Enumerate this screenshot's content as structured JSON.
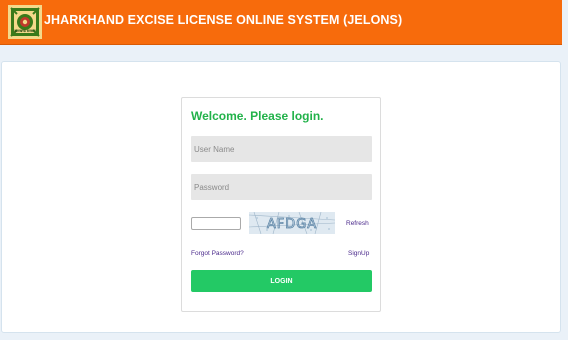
{
  "header": {
    "title": "JHARKHAND EXCISE LICENSE ONLINE SYSTEM (JELONS)",
    "logo_caption": "झारखण्ड सरकार",
    "background_color": "#f76b0c"
  },
  "login": {
    "welcome": "Welcome. Please login.",
    "username_placeholder": "User Name",
    "password_placeholder": "Password",
    "captcha_value": "",
    "captcha_text": "AFDGA",
    "refresh_label": "Refresh",
    "forgot_label": "Forgot Password?",
    "signup_label": "SignUp",
    "login_button": "LOGIN",
    "accent_color": "#23c965",
    "welcome_color": "#22b24a"
  }
}
